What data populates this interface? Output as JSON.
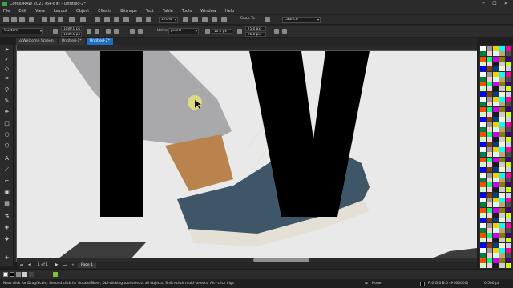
{
  "window": {
    "title": "CorelDRAW 2021 (64-Bit) - Untitled-2*",
    "minimize_glyph": "─",
    "maximize_glyph": "☐",
    "close_glyph": "✕"
  },
  "menu": [
    "File",
    "Edit",
    "View",
    "Layout",
    "Object",
    "Effects",
    "Bitmaps",
    "Text",
    "Table",
    "Tools",
    "Window",
    "Help"
  ],
  "standard_toolbar": {
    "zoom_value": "170%",
    "snap_to_label": "Snap To",
    "launch_label": "Launch"
  },
  "property_bar": {
    "preset": "Custom",
    "page_width": "1080.0 px",
    "page_height": "1080.0 px",
    "units_label": "Units:",
    "units_value": "pixels",
    "nudge_value": "10.0 px",
    "dup_x": "75.0 px",
    "dup_y": "75.0 px"
  },
  "document_tabs": [
    {
      "label": "Welcome Screen",
      "active": false
    },
    {
      "label": "Untitled-1*",
      "active": false
    },
    {
      "label": "Untitled-2*",
      "active": true
    }
  ],
  "toolbox_icons": [
    "pick-tool-icon",
    "freehand-pick-icon",
    "shape-tool-icon",
    "crop-tool-icon",
    "zoom-tool-icon",
    "freehand-tool-icon",
    "artistic-media-icon",
    "rectangle-tool-icon",
    "ellipse-tool-icon",
    "polygon-tool-icon",
    "text-tool-icon",
    "parallel-dimension-icon",
    "connector-tool-icon",
    "drop-shadow-icon",
    "transparency-tool-icon",
    "eyedropper-tool-icon",
    "interactive-fill-icon",
    "smart-fill-icon",
    "add-tool-icon"
  ],
  "page_nav": {
    "page_of": "1 of 1",
    "page_tab": "Page 1"
  },
  "status": {
    "hint": "Next click for Drag/Scale; Second click for Rotate/Skew; Dbl-clicking tool selects all objects; Shift+click multi-selects; Alt+click digs",
    "fill_label": "None",
    "color_readout": "R:0 G:0 B:0 (#000000)",
    "stroke_width": "0.500 pt"
  },
  "colors": {
    "accent_blue": "#1f6fc0",
    "canvas_bg": "#e9e9e9",
    "letter_fill": "#000000",
    "cursor_highlight": "#e4e37a"
  }
}
